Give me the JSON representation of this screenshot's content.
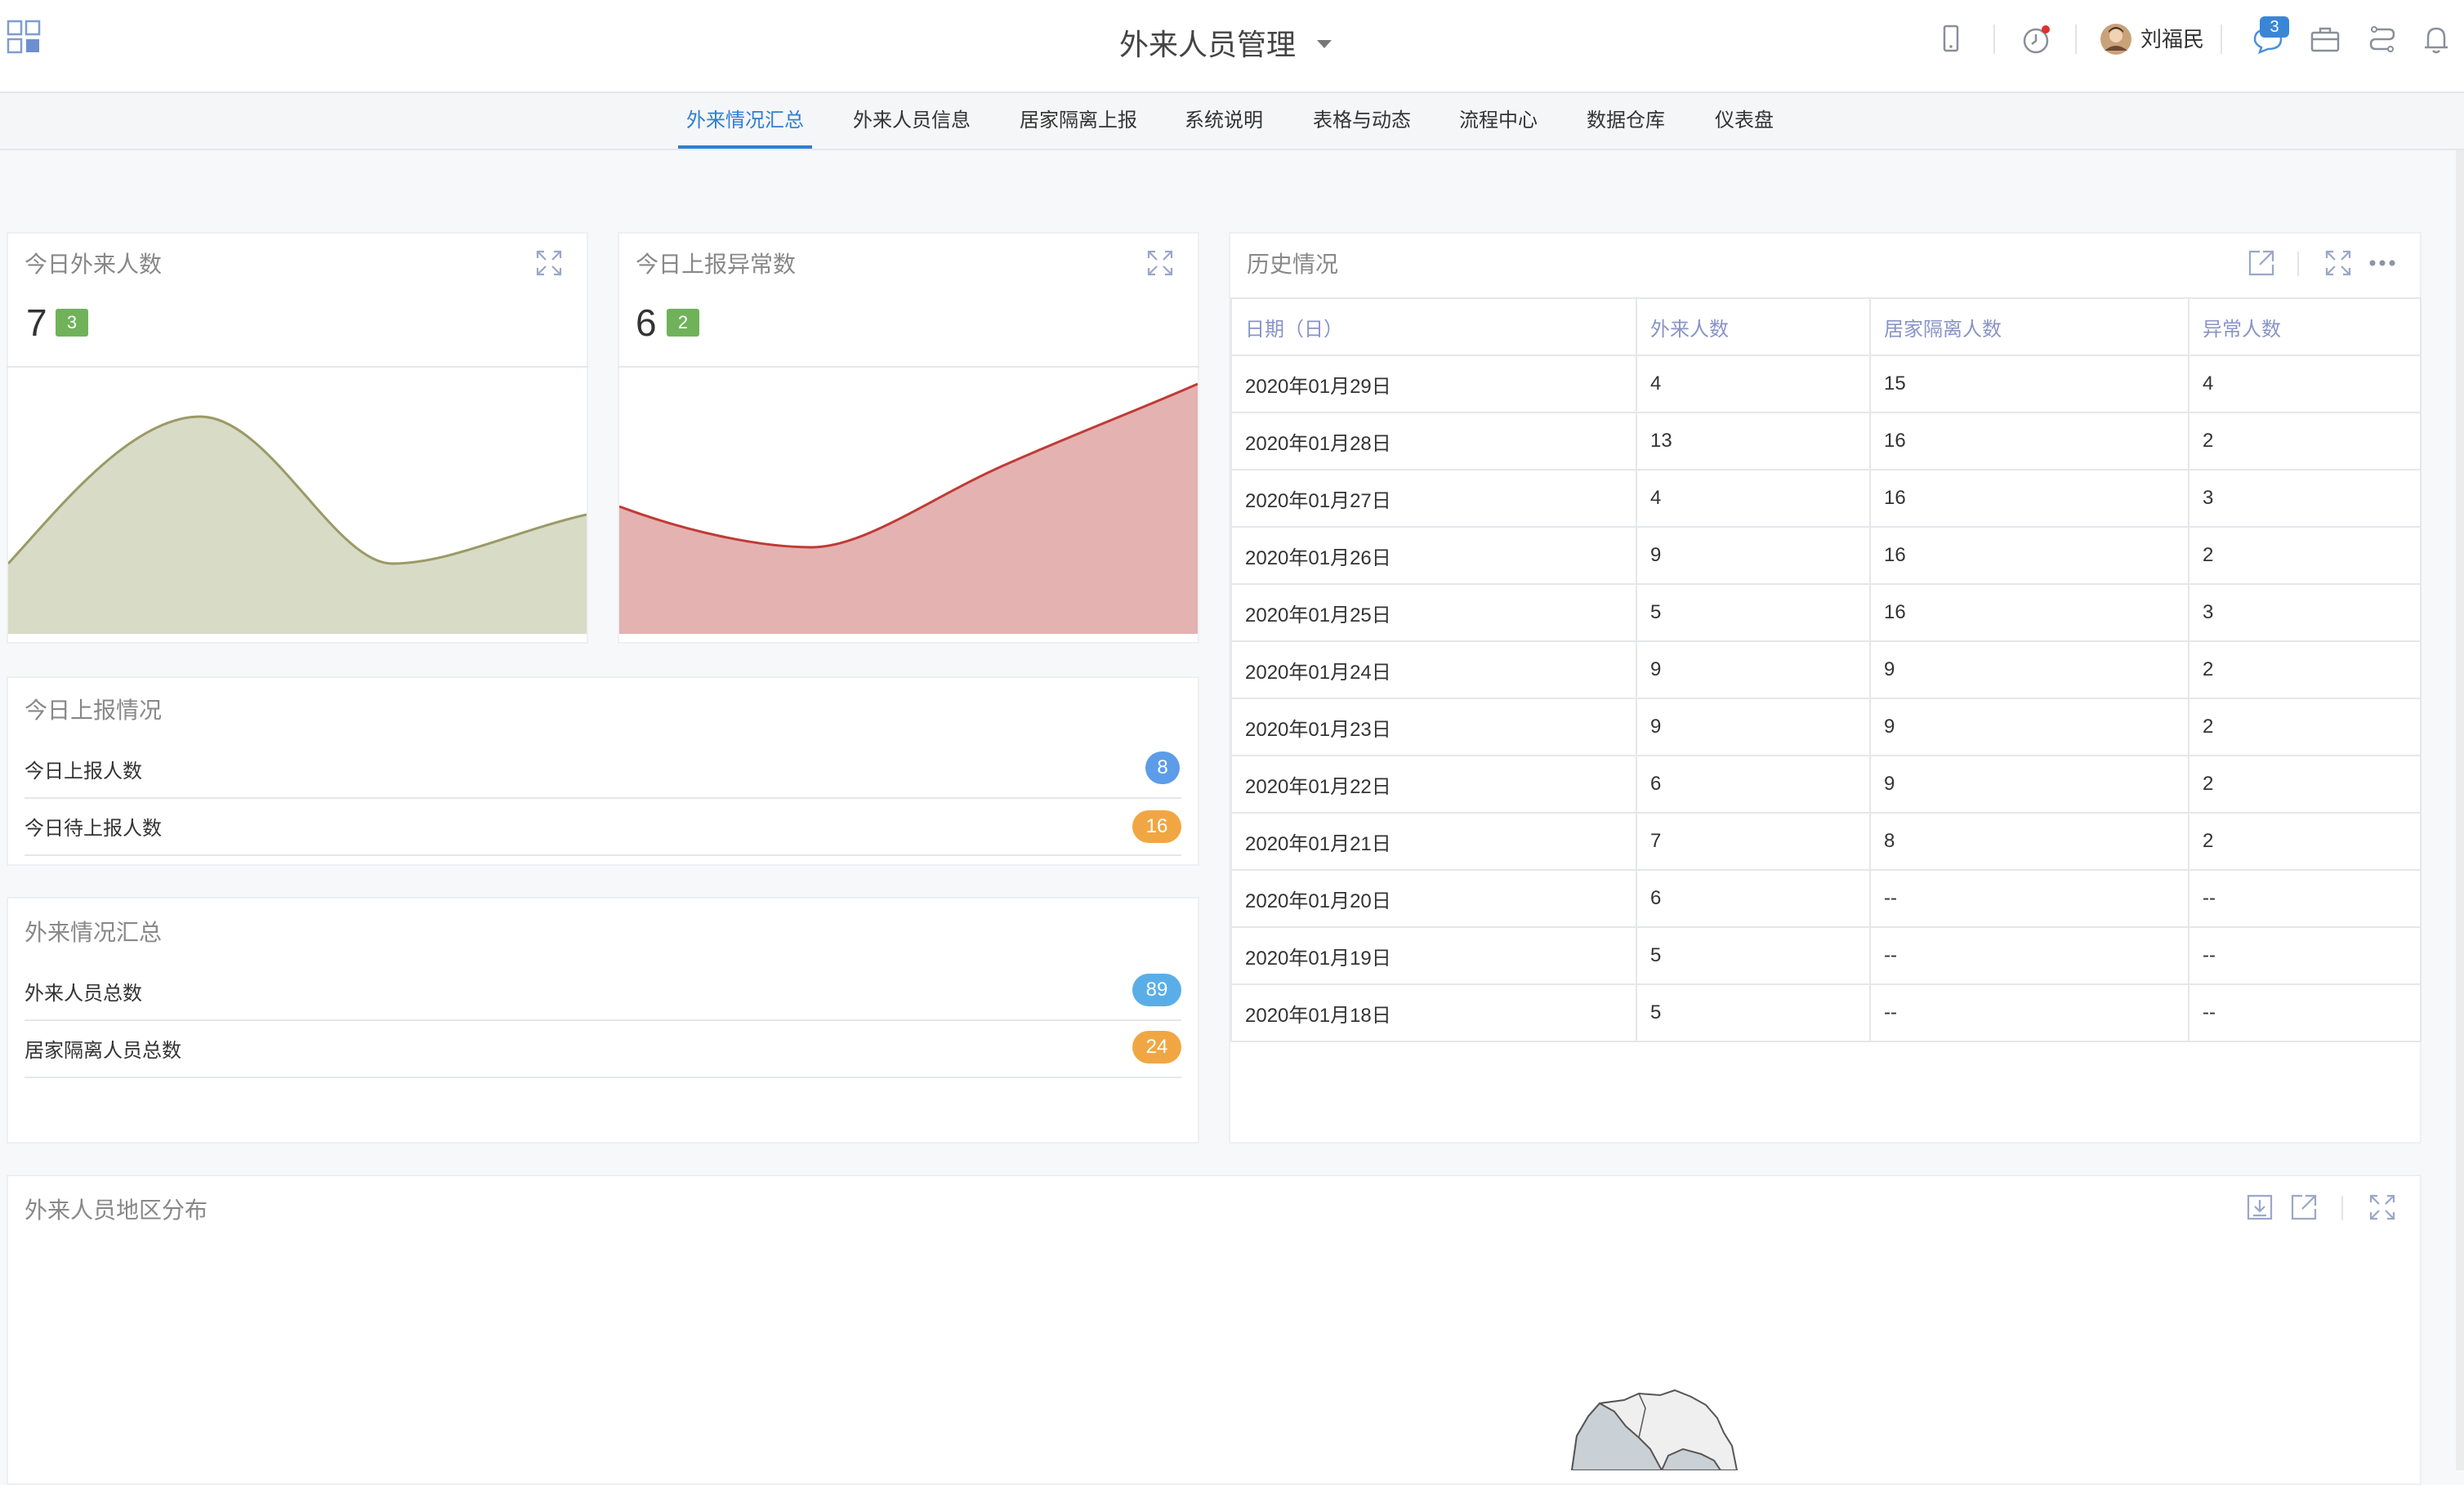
{
  "header": {
    "title": "外来人员管理",
    "user_name": "刘福民",
    "message_badge": "3"
  },
  "tabs": [
    {
      "label": "外来情况汇总",
      "active": true
    },
    {
      "label": "外来人员信息"
    },
    {
      "label": "居家隔离上报"
    },
    {
      "label": "系统说明"
    },
    {
      "label": "表格与动态"
    },
    {
      "label": "流程中心"
    },
    {
      "label": "数据仓库"
    },
    {
      "label": "仪表盘"
    }
  ],
  "kpi_visitors": {
    "title": "今日外来人数",
    "value": "7",
    "tag": "3"
  },
  "kpi_abnormal": {
    "title": "今日上报异常数",
    "value": "6",
    "tag": "2"
  },
  "report_today": {
    "title": "今日上报情况",
    "rows": [
      {
        "label": "今日上报人数",
        "count": "8",
        "color": "#5d9ce8"
      },
      {
        "label": "今日待上报人数",
        "count": "16",
        "color": "#f0a743"
      }
    ]
  },
  "summary": {
    "title": "外来情况汇总",
    "rows": [
      {
        "label": "外来人员总数",
        "count": "89",
        "color": "#5aaee8"
      },
      {
        "label": "居家隔离人员总数",
        "count": "24",
        "color": "#f0a743"
      }
    ]
  },
  "history": {
    "title": "历史情况",
    "columns": [
      "日期（日）",
      "外来人数",
      "居家隔离人数",
      "异常人数"
    ],
    "rows": [
      [
        "2020年01月29日",
        "4",
        "15",
        "4"
      ],
      [
        "2020年01月28日",
        "13",
        "16",
        "2"
      ],
      [
        "2020年01月27日",
        "4",
        "16",
        "3"
      ],
      [
        "2020年01月26日",
        "9",
        "16",
        "2"
      ],
      [
        "2020年01月25日",
        "5",
        "16",
        "3"
      ],
      [
        "2020年01月24日",
        "9",
        "9",
        "2"
      ],
      [
        "2020年01月23日",
        "9",
        "9",
        "2"
      ],
      [
        "2020年01月22日",
        "6",
        "9",
        "2"
      ],
      [
        "2020年01月21日",
        "7",
        "8",
        "2"
      ],
      [
        "2020年01月20日",
        "6",
        "--",
        "--"
      ],
      [
        "2020年01月19日",
        "5",
        "--",
        "--"
      ],
      [
        "2020年01月18日",
        "5",
        "--",
        "--"
      ]
    ]
  },
  "region": {
    "title": "外来人员地区分布"
  },
  "colors": {
    "accent": "#2f7fd1",
    "tag_green": "#70b25a",
    "spark_olive_fill": "#d8dbc6",
    "spark_olive_line": "#9a9a66",
    "spark_red_fill": "#e3b2b1",
    "spark_red_line": "#bf3b36"
  }
}
